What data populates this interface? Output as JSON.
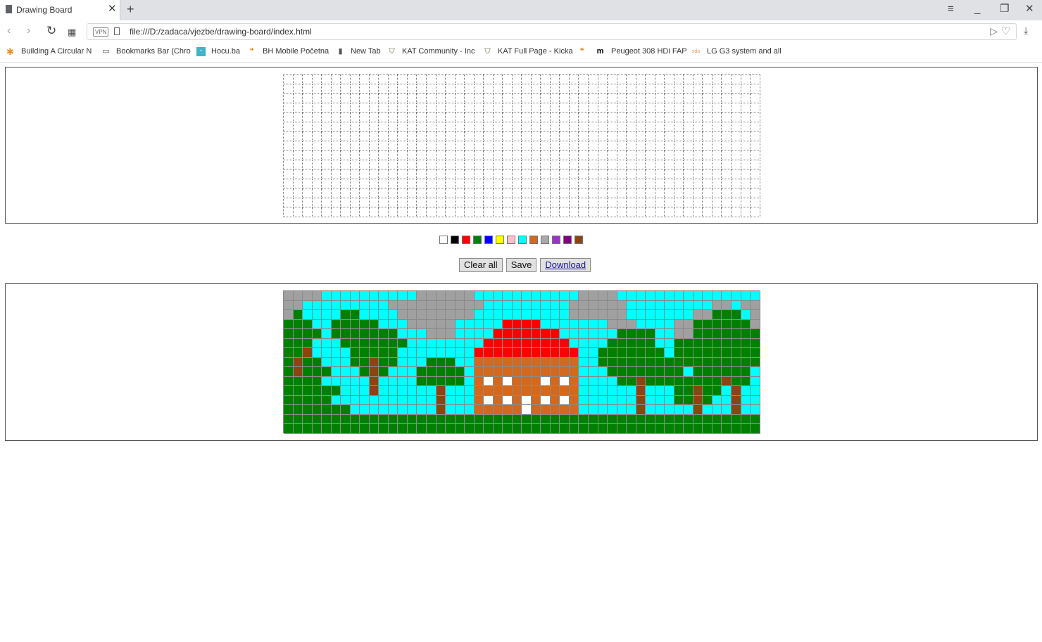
{
  "browser": {
    "tab_title": "Drawing Board",
    "new_tab_symbol": "+",
    "url": "file:///D:/zadaca/vjezbe/drawing-board/index.html",
    "vpn_label": "VPN",
    "bookmarks": [
      {
        "label": "Building A Circular N",
        "icon": "starburst-icon"
      },
      {
        "label": "Bookmarks Bar (Chro",
        "icon": "folder-icon"
      },
      {
        "label": "Hocu.ba",
        "icon": "hocu-icon"
      },
      {
        "label": "BH Mobile Početna",
        "icon": "bhmobile-icon"
      },
      {
        "label": "New Tab",
        "icon": "page-icon"
      },
      {
        "label": "KAT Community - Inc",
        "icon": "shield-icon"
      },
      {
        "label": "KAT Full Page - Kicka",
        "icon": "shield-icon"
      },
      {
        "label": "",
        "icon": "bhmobile-icon"
      },
      {
        "label": "Peugeot 308 HDi FAP",
        "icon": "m-icon"
      },
      {
        "label": "LG G3 system and all",
        "icon": "xda-icon"
      }
    ]
  },
  "colors": {
    "palette": [
      "#ffffff",
      "#000000",
      "#ff0000",
      "#008000",
      "#0000ff",
      "#ffff00",
      "#ffc0cb",
      "#00ffff",
      "#d2691e",
      "#a9a9a9",
      "#9932cc",
      "#800080",
      "#8b4513"
    ],
    "legend": {
      "S": "#00ffff",
      "G": "#a0a0a0",
      "T": "#008000",
      "B": "#8b4513",
      "R": "#ff0000",
      "H": "#d2691e",
      "W": "#ffffff"
    }
  },
  "drawing": {
    "cols": 50,
    "rows_count": 15,
    "saved_rows": [
      "GGGGSSSSSSSSSSGGGGGGSSSSSSSSSSSGGGGSSSSSSSSSSSSSSS",
      "GGSSSSSSSSSGGGGGGGGGGSSSSSSSSSGGGGGGSSSSSSSSSGGSGG",
      "GTSSSSTTSSSSGGGGGGGGSSSSSSSSSSGGGGGGSSSSSSSGGTTTSG",
      "TTTSSTTTTTSSSGGGGGSSSSSRRRRSSSSSSSGGGSSSSGGTTTTTTG",
      "TTTTSTTTTTTTSSSGGGSSSSRRRRRRRSSSSSSTTTTSSGGTTTTTTT",
      "TTTSSSTTTTTTTSSSSSSSSRRRRRRRRRSSSSTTTTTSSTTTTTTTTT",
      "TTBSSSSTTTTTSSSSSSSSRRRRRRRRRRRSSTTTTTTTSTTTTTTTTT",
      "TBTTSSSTTBTTSSSTTTSSHHHHHHHHHHHSSTTTTTTTTTTTTTTTTT",
      "TBTTTSSSTBTSSSTTTTTSHHHHHHHHHHHSSSTTTTTTTTSTTTTTTS",
      "TTTTSSSSSBSSSSTTTTTSHWHWHHHWHWHSSSSTTBTTTTTTTTBTTS",
      "TTTTTTSSSBSSSSSSBSSSHHHHHHHHHHHSSSSSSBSSSTTBTTSBSS",
      "TTTTTSSSSSSSSSSSBSSSHWHWHWHWHWHSSSSSSBSSSTTBTSSBSS",
      "TTTTTTTSSSSSSSSSBSSSHHHHHWHHHHHSSSSSSBSSSSSBSSSBSS",
      "TTTTTTTTTTTTTTTTTTTTTTTTTTTTTTTTTTTTTTTTTTTTTTTTTT",
      "TTTTTTTTTTTTTTTTTTTTTTTTTTTTTTTTTTTTTTTTTTTTTTTTTT"
    ]
  },
  "controls": {
    "clear_label": "Clear all",
    "save_label": "Save",
    "download_label": "Download"
  }
}
